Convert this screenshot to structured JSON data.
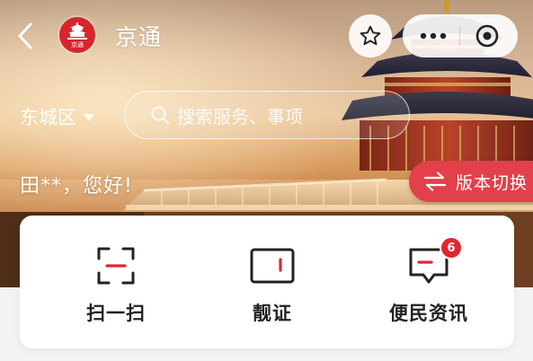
{
  "header": {
    "logo_text": "京通",
    "title": "京通"
  },
  "location": {
    "district": "东城区"
  },
  "search": {
    "placeholder": "搜索服务、事项"
  },
  "greeting": "田**，您好!",
  "version_switch": {
    "label": "版本切换"
  },
  "quick_actions": [
    {
      "label": "扫一扫",
      "icon": "scan-icon"
    },
    {
      "label": "靓证",
      "icon": "id-card-icon"
    },
    {
      "label": "便民资讯",
      "icon": "message-icon",
      "badge": "6"
    }
  ],
  "colors": {
    "accent": "#e2262f",
    "switch_bg": "#e2404a"
  }
}
